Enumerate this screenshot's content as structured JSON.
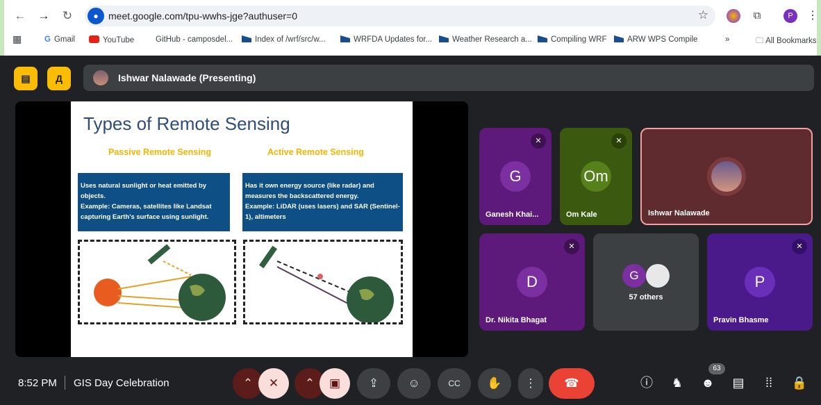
{
  "browser": {
    "url": "meet.google.com/tpu-wwhs-jge?authuser=0",
    "profile_initial": "P",
    "bookmarks": [
      "Gmail",
      "YouTube",
      "GitHub - camposdel...",
      "Index of /wrf/src/w...",
      "WRFDA Updates for...",
      "Weather Research a...",
      "Compiling WRF",
      "ARW WPS Compile"
    ],
    "more": "»",
    "all_bookmarks": "All Bookmarks"
  },
  "presenter_bar": {
    "name": "Ishwar Nalawade (Presenting)"
  },
  "slide": {
    "title": "Types of Remote Sensing",
    "passive_heading": "Passive Remote Sensing",
    "active_heading": "Active Remote Sensing",
    "passive_text": "Uses natural sunlight or heat emitted by objects.\nExample: Cameras, satellites like Landsat capturing Earth's surface using sunlight.",
    "active_text": "Has it own energy source (like radar) and measures the backscattered energy.\nExample: LiDAR (uses lasers) and SAR (Sentinel-1), altimeters"
  },
  "participants": [
    {
      "name": "Ganesh Khai...",
      "initial": "G",
      "color": "#5e1a7a"
    },
    {
      "name": "Om Kale",
      "initial": "Om",
      "color": "#3b5a10"
    },
    {
      "name": "Ishwar Nalawade",
      "initial": "",
      "color": "#5f2b2e"
    },
    {
      "name": "Dr. Nikita Bhagat",
      "initial": "D",
      "color": "#5e1a7a"
    },
    {
      "name": "57 others",
      "initial": "G",
      "color": "#3c4043"
    },
    {
      "name": "Pravin Bhasme",
      "initial": "P",
      "color": "#4a1a8a"
    }
  ],
  "footer": {
    "time": "8:52 PM",
    "meeting_name": "GIS Day Celebration",
    "people_count": "63"
  },
  "colors": {
    "accent_yellow": "#fbbc04",
    "hangup_red": "#ea4335",
    "bg": "#202124"
  },
  "icons": [
    "back-icon",
    "forward-icon",
    "reload-icon",
    "mic-icon",
    "star-icon",
    "extension-icon",
    "kebab-icon",
    "apps-icon",
    "folder-icon",
    "mic-off-icon",
    "camera-off-icon",
    "present-icon",
    "emoji-icon",
    "captions-icon",
    "hand-icon",
    "more-icon",
    "hangup-icon",
    "info-icon",
    "host-icon",
    "people-icon",
    "chat-icon",
    "activities-icon",
    "lock-icon"
  ]
}
